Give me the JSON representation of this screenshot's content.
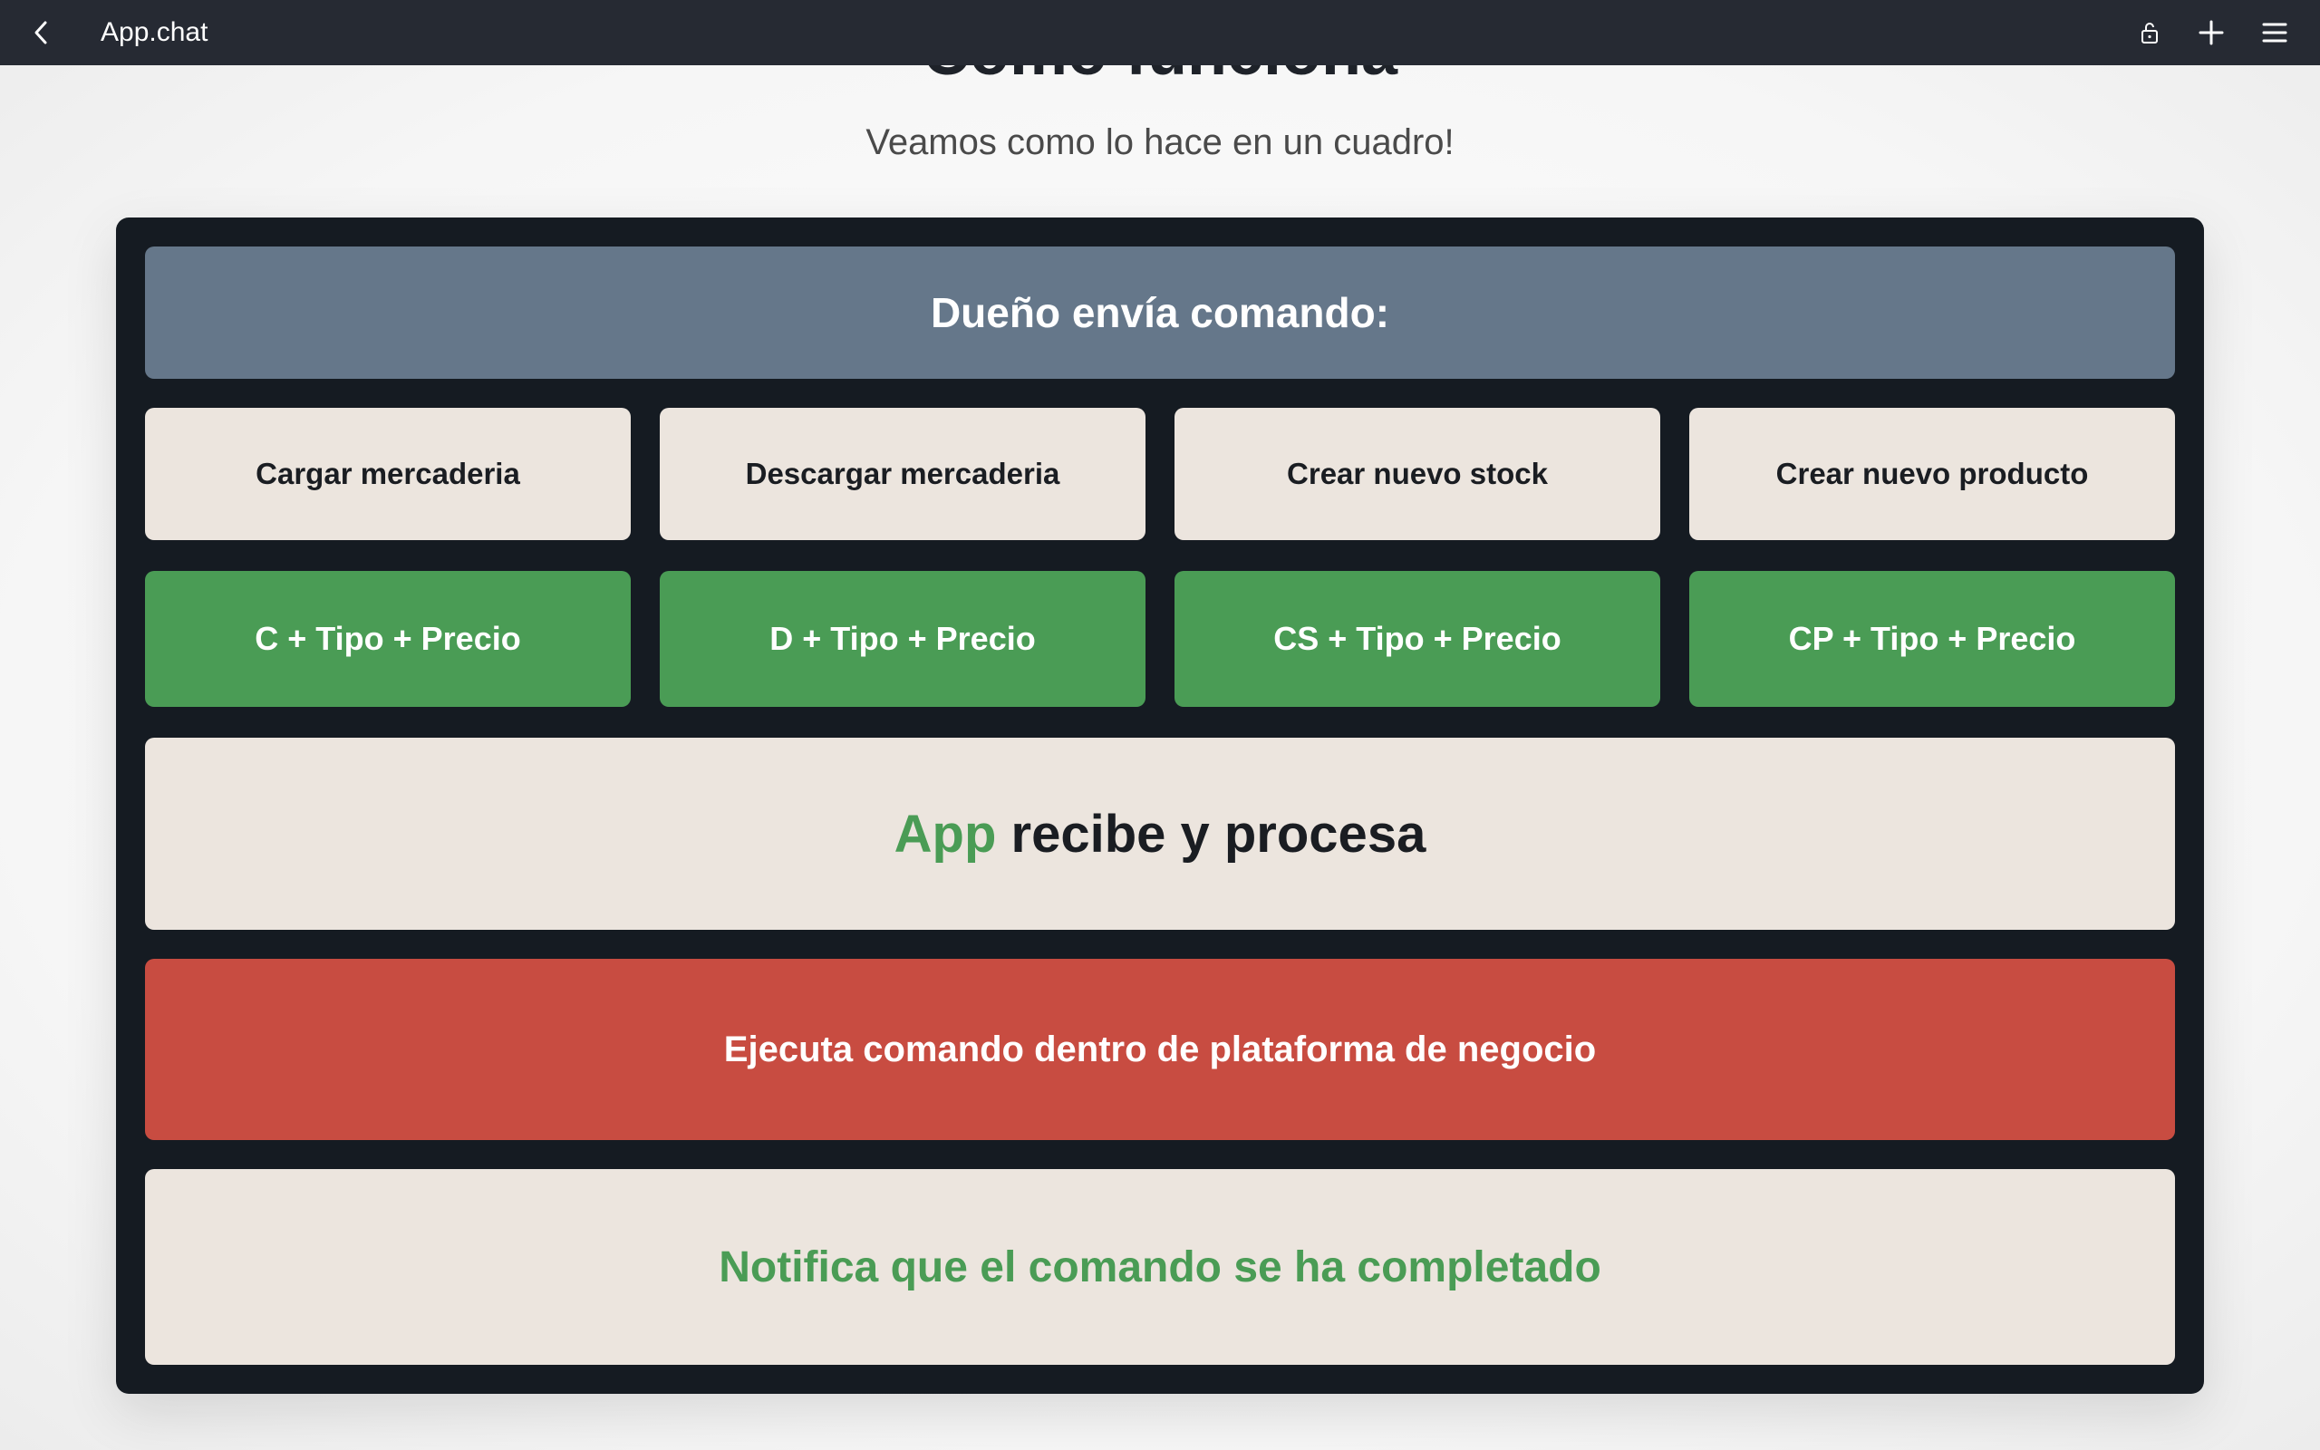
{
  "topbar": {
    "title": "App.chat",
    "icons": [
      "chevron-left-icon",
      "lock-icon",
      "plus-icon",
      "menu-icon"
    ]
  },
  "page": {
    "heading_partial": "Como funciona",
    "subtitle": "Veamos como lo hace en un cuadro!"
  },
  "diagram": {
    "header": "Dueño envía comando:",
    "actions": [
      "Cargar mercaderia",
      "Descargar mercaderia",
      "Crear nuevo stock",
      "Crear nuevo producto"
    ],
    "commands": [
      "C + Tipo + Precio",
      "D + Tipo + Precio",
      "CS + Tipo + Precio",
      "CP + Tipo + Precio"
    ],
    "process_accent": "App",
    "process_rest": " recibe y procesa",
    "execute": "Ejecuta comando dentro de plataforma de negocio",
    "notify": "Notifica que el comando se ha completado"
  },
  "colors": {
    "topbar": "#262a33",
    "board": "#151b22",
    "header_block": "#65778a",
    "light_block": "#ece5de",
    "green": "#4a9c55",
    "red": "#c84c41"
  }
}
